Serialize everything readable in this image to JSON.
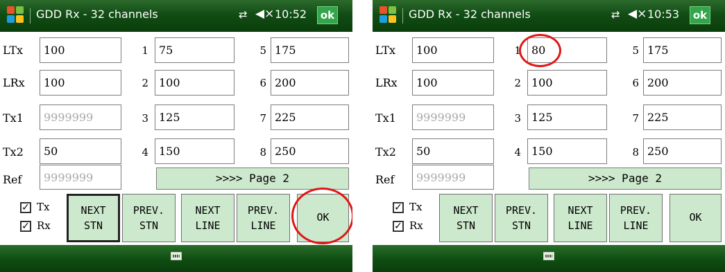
{
  "screens": [
    {
      "title": "GDD Rx - 32 channels",
      "clock": "10:52",
      "ok_label": "ok",
      "labels": {
        "ltx": "LTx",
        "lrx": "LRx",
        "tx1": "Tx1",
        "tx2": "Tx2",
        "ref": "Ref"
      },
      "fields": {
        "ltx": "100",
        "lrx": "100",
        "tx1": "9999999",
        "tx2": "50",
        "ref": "9999999"
      },
      "channels": [
        {
          "n": "1",
          "v": "75"
        },
        {
          "n": "2",
          "v": "100"
        },
        {
          "n": "3",
          "v": "125"
        },
        {
          "n": "4",
          "v": "150"
        },
        {
          "n": "5",
          "v": "175"
        },
        {
          "n": "6",
          "v": "200"
        },
        {
          "n": "7",
          "v": "225"
        },
        {
          "n": "8",
          "v": "250"
        }
      ],
      "page_button": ">>>> Page 2",
      "checks": {
        "tx_label": "Tx",
        "rx_label": "Rx",
        "tx_checked": true,
        "rx_checked": true
      },
      "buttons": {
        "next_stn": [
          "NEXT",
          "STN"
        ],
        "prev_stn": [
          "PREV.",
          "STN"
        ],
        "next_line": [
          "NEXT",
          "LINE"
        ],
        "prev_line": [
          "PREV.",
          "LINE"
        ],
        "ok": "OK"
      },
      "highlight": "ok-button"
    },
    {
      "title": "GDD Rx - 32 channels",
      "clock": "10:53",
      "ok_label": "ok",
      "labels": {
        "ltx": "LTx",
        "lrx": "LRx",
        "tx1": "Tx1",
        "tx2": "Tx2",
        "ref": "Ref"
      },
      "fields": {
        "ltx": "100",
        "lrx": "100",
        "tx1": "9999999",
        "tx2": "50",
        "ref": "9999999"
      },
      "channels": [
        {
          "n": "1",
          "v": "80"
        },
        {
          "n": "2",
          "v": "100"
        },
        {
          "n": "3",
          "v": "125"
        },
        {
          "n": "4",
          "v": "150"
        },
        {
          "n": "5",
          "v": "175"
        },
        {
          "n": "6",
          "v": "200"
        },
        {
          "n": "7",
          "v": "225"
        },
        {
          "n": "8",
          "v": "250"
        }
      ],
      "page_button": ">>>> Page 2",
      "checks": {
        "tx_label": "Tx",
        "rx_label": "Rx",
        "tx_checked": true,
        "rx_checked": true
      },
      "buttons": {
        "next_stn": [
          "NEXT",
          "STN"
        ],
        "prev_stn": [
          "PREV.",
          "STN"
        ],
        "next_line": [
          "NEXT",
          "LINE"
        ],
        "prev_line": [
          "PREV.",
          "LINE"
        ],
        "ok": "OK"
      },
      "highlight": "channel-1-field"
    }
  ],
  "colors": {
    "titlebar": "#114d14",
    "button_fill": "#cde9cd",
    "highlight_circle": "#e01515",
    "ok_badge": "#33a54a"
  },
  "icons": {
    "logo": "windows-logo-icon",
    "sync": "sync-arrows-icon",
    "volume": "speaker-mute-icon",
    "keyboard": "keyboard-icon"
  }
}
